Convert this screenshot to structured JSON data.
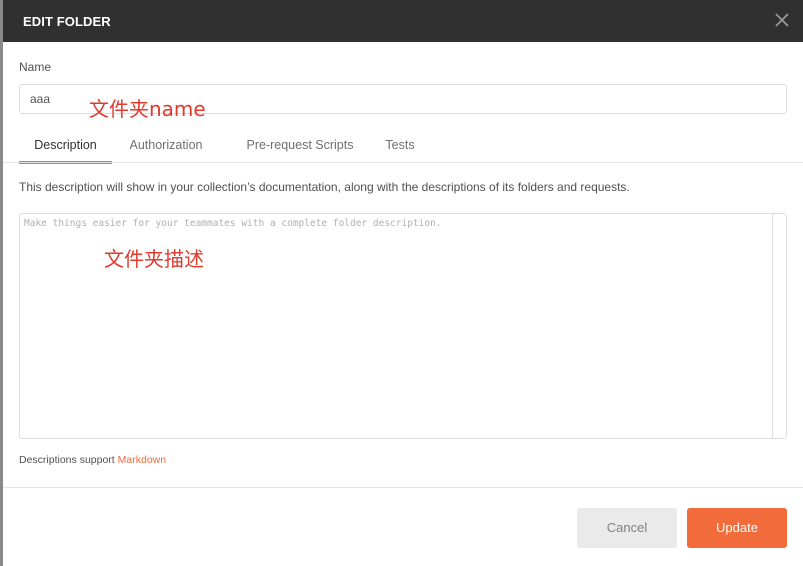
{
  "dialog": {
    "title": "EDIT FOLDER",
    "close_icon": "close-icon"
  },
  "name_field": {
    "label": "Name",
    "value": "aaa"
  },
  "annotations": {
    "name_note": "文件夹name",
    "description_note": "文件夹描述",
    "color": "#e03a2f"
  },
  "tabs": [
    {
      "label": "Description",
      "active": true
    },
    {
      "label": "Authorization",
      "active": false
    },
    {
      "label": "Pre-request Scripts",
      "active": false
    },
    {
      "label": "Tests",
      "active": false
    }
  ],
  "description": {
    "help_text": "This description will show in your collection’s documentation, along with the descriptions of its folders and requests.",
    "placeholder": "Make things easier for your teammates with a complete folder description.",
    "value": ""
  },
  "markdown_note": {
    "prefix": "Descriptions support ",
    "link": "Markdown"
  },
  "footer": {
    "cancel_label": "Cancel",
    "update_label": "Update"
  },
  "colors": {
    "header_bg": "#303030",
    "accent": "#f26b3a",
    "cancel_bg": "#eaeaea"
  }
}
